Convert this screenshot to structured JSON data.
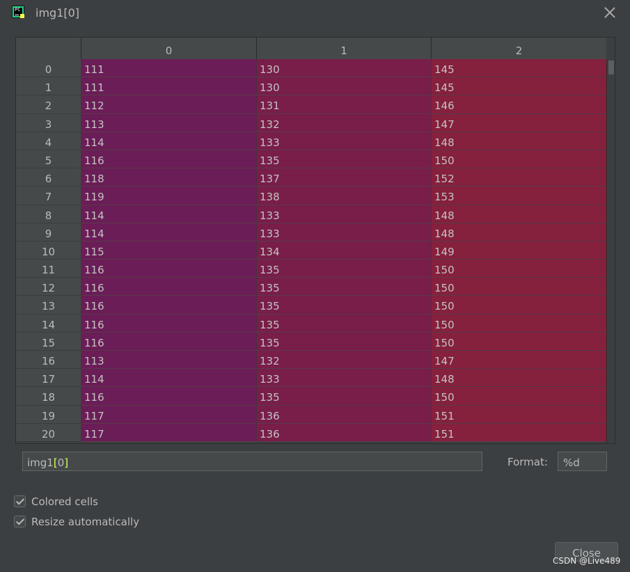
{
  "window": {
    "title": "img1[0]"
  },
  "table": {
    "columns": [
      "0",
      "1",
      "2"
    ],
    "rows": [
      {
        "index": "0",
        "values": [
          "111",
          "130",
          "145"
        ]
      },
      {
        "index": "1",
        "values": [
          "111",
          "130",
          "145"
        ]
      },
      {
        "index": "2",
        "values": [
          "112",
          "131",
          "146"
        ]
      },
      {
        "index": "3",
        "values": [
          "113",
          "132",
          "147"
        ]
      },
      {
        "index": "4",
        "values": [
          "114",
          "133",
          "148"
        ]
      },
      {
        "index": "5",
        "values": [
          "116",
          "135",
          "150"
        ]
      },
      {
        "index": "6",
        "values": [
          "118",
          "137",
          "152"
        ]
      },
      {
        "index": "7",
        "values": [
          "119",
          "138",
          "153"
        ]
      },
      {
        "index": "8",
        "values": [
          "114",
          "133",
          "148"
        ]
      },
      {
        "index": "9",
        "values": [
          "114",
          "133",
          "148"
        ]
      },
      {
        "index": "10",
        "values": [
          "115",
          "134",
          "149"
        ]
      },
      {
        "index": "11",
        "values": [
          "116",
          "135",
          "150"
        ]
      },
      {
        "index": "12",
        "values": [
          "116",
          "135",
          "150"
        ]
      },
      {
        "index": "13",
        "values": [
          "116",
          "135",
          "150"
        ]
      },
      {
        "index": "14",
        "values": [
          "116",
          "135",
          "150"
        ]
      },
      {
        "index": "15",
        "values": [
          "116",
          "135",
          "150"
        ]
      },
      {
        "index": "16",
        "values": [
          "113",
          "132",
          "147"
        ]
      },
      {
        "index": "17",
        "values": [
          "114",
          "133",
          "148"
        ]
      },
      {
        "index": "18",
        "values": [
          "116",
          "135",
          "150"
        ]
      },
      {
        "index": "19",
        "values": [
          "117",
          "136",
          "151"
        ]
      },
      {
        "index": "20",
        "values": [
          "117",
          "136",
          "151"
        ]
      }
    ],
    "cell_colors": [
      "#6a1d56",
      "#781e48",
      "#85203d"
    ]
  },
  "expression": {
    "prefix": "img1",
    "open": "[",
    "index": "0",
    "close": "]"
  },
  "format": {
    "label": "Format:",
    "value": "%d"
  },
  "options": {
    "colored_cells": {
      "label": "Colored cells",
      "checked": true
    },
    "resize_automatically": {
      "label": "Resize automatically",
      "checked": true
    }
  },
  "buttons": {
    "close": "Close"
  },
  "watermark": "CSDN @Live489"
}
